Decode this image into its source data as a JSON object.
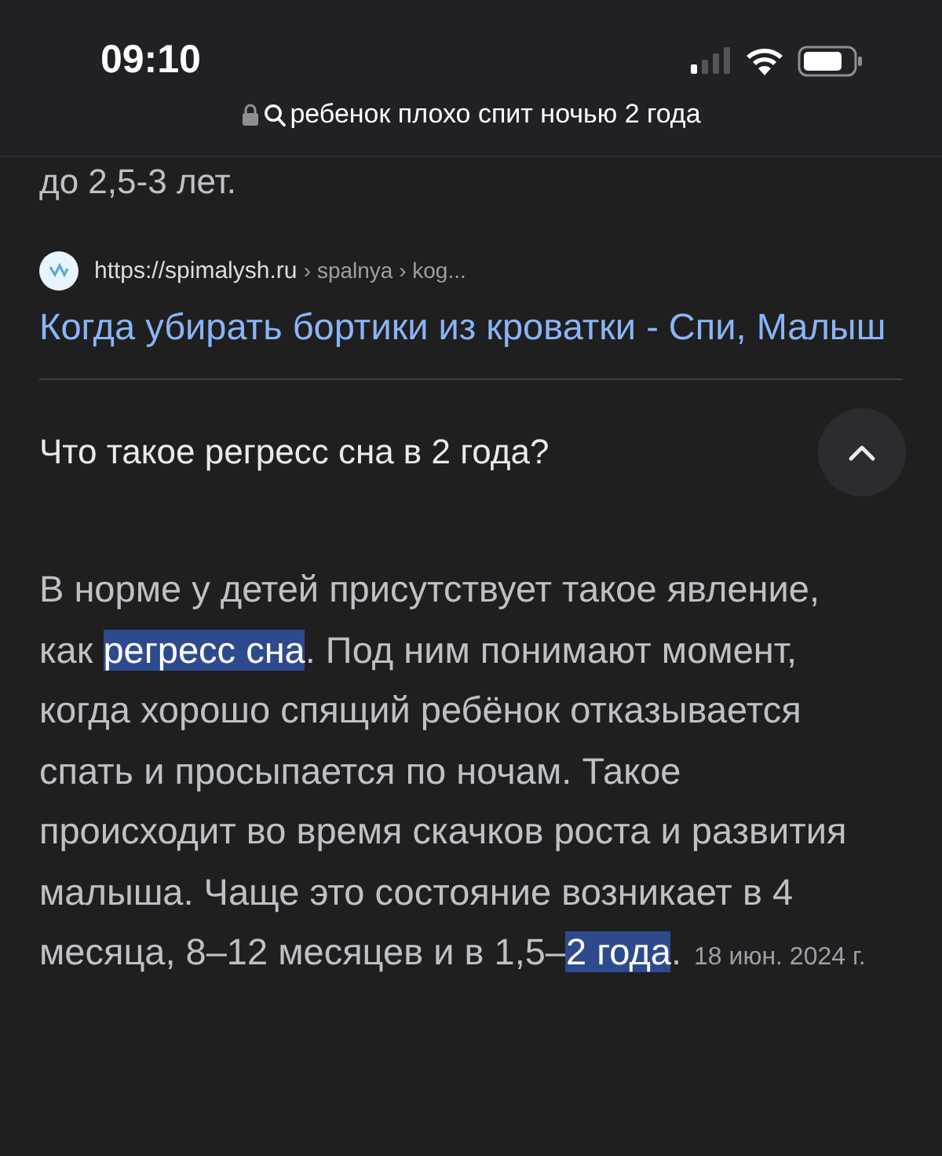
{
  "status_bar": {
    "time": "09:10",
    "address": "ребенок плохо спит ночью 2 года"
  },
  "previous_text": "до 2,5-3 лет.",
  "result": {
    "url": "https://spimalysh.ru",
    "breadcrumbs": "› spalnya › kog...",
    "title": "Когда убирать бортики из кроватки - Спи, Малыш"
  },
  "question": {
    "text": "Что такое регресс сна в 2 года?",
    "expanded": true
  },
  "answer": {
    "segments": [
      {
        "text": "В норме у детей присутствует такое явление, как ",
        "highlighted": false
      },
      {
        "text": "регресс сна",
        "highlighted": true
      },
      {
        "text": ". Под ним понимают момент, когда хорошо спящий ребёнок отказывается спать и просыпается по ночам. Такое происходит во время скачков роста и развития малыша. Чаще это состояние возникает в 4 месяца, 8–12 месяцев и в 1,5–",
        "highlighted": false
      },
      {
        "text": "2 года",
        "highlighted": true
      },
      {
        "text": ".",
        "highlighted": false
      }
    ],
    "date": "18 июн. 2024 г."
  }
}
